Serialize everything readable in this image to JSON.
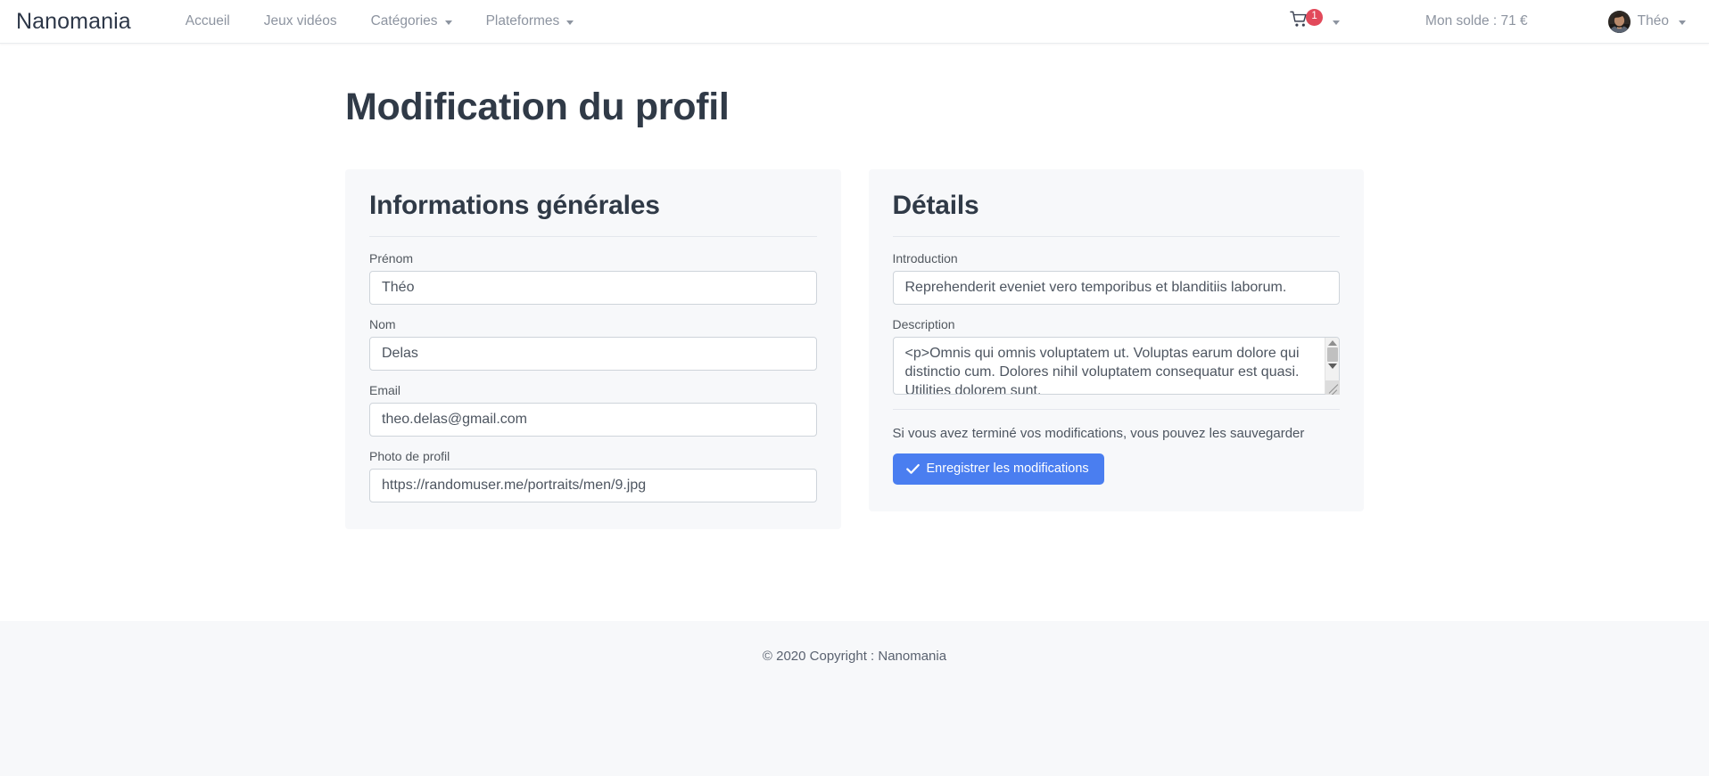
{
  "navbar": {
    "brand": "Nanomania",
    "links": [
      {
        "label": "Accueil",
        "dropdown": false
      },
      {
        "label": "Jeux vidéos",
        "dropdown": false
      },
      {
        "label": "Catégories",
        "dropdown": true
      },
      {
        "label": "Plateformes",
        "dropdown": true
      }
    ],
    "cart": {
      "icon": "shopping-cart-icon",
      "badge_count": "1",
      "badge_color": "#e2495a"
    },
    "balance_label": "Mon solde : 71 €",
    "user": {
      "name": "Théo",
      "avatar_icon": "user-avatar-photo"
    }
  },
  "main": {
    "page_title": "Modification du profil",
    "general_card": {
      "title": "Informations générales",
      "fields": [
        {
          "label": "Prénom",
          "value": "Théo",
          "placeholder": "Prénom",
          "name": "firstname"
        },
        {
          "label": "Nom",
          "value": "Delas",
          "placeholder": "Nom",
          "name": "lastname"
        },
        {
          "label": "Email",
          "value": "theo.delas@gmail.com",
          "placeholder": "Email",
          "name": "email"
        },
        {
          "label": "Photo de profil",
          "value": "https://randomuser.me/portraits/men/9.jpg",
          "placeholder": "Photo de profil",
          "name": "avatar-url"
        }
      ]
    },
    "details_card": {
      "title": "Détails",
      "introduction": {
        "label": "Introduction",
        "value": "Reprehenderit eveniet vero temporibus et blanditiis laborum.",
        "placeholder": "Introduction"
      },
      "description": {
        "label": "Description",
        "value": "<p>Omnis qui omnis voluptatem ut. Voluptas earum dolore qui distinctio cum. Dolores nihil voluptatem consequatur est quasi. Utilities dolorem sunt.",
        "placeholder": "Description"
      },
      "save_hint": "Si vous avez terminé vos modifications, vous pouvez les sauvegarder",
      "save_button": {
        "label": "Enregistrer les modifications",
        "icon": "check-icon",
        "color": "#4a7ef0"
      }
    }
  },
  "footer": {
    "copyright": "© 2020 Copyright : Nanomania"
  }
}
